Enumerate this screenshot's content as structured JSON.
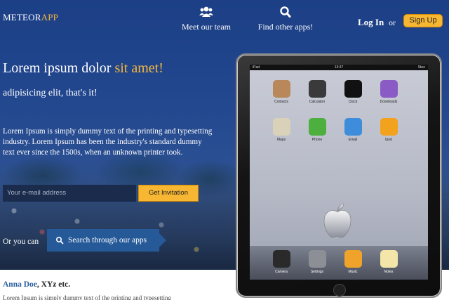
{
  "header": {
    "logo_main": "METEOR",
    "logo_accent": "APP",
    "nav": [
      {
        "label": "Meet our team",
        "icon": "users-icon"
      },
      {
        "label": "Find other apps!",
        "icon": "search-icon"
      }
    ],
    "login_label": "Log In",
    "or_label": "or",
    "signup_label": "Sign Up"
  },
  "hero": {
    "headline_main": "Lorem ipsum dolor ",
    "headline_accent": "sit amet!",
    "subheadline": "adipisicing elit, that's it!",
    "description": "Lorem Ipsum is simply dummy text of the printing and typesetting industry. Lorem Ipsum has been the industry's standard dummy text ever since the 1500s, when an unknown printer took.",
    "email_placeholder": "Your e-mail address",
    "invite_label": "Get Invitation",
    "or_you_can": "Or you can",
    "search_label": "Search through our apps"
  },
  "testimonial": {
    "author_name": "Anna Doe",
    "author_rest": ", XYz etc.",
    "text": "Lorem Ipsum is simply dummy text of the printing and typesetting"
  },
  "tablet": {
    "status_left": "iPad",
    "status_center": "13:37",
    "status_right": "Stee",
    "apps": [
      {
        "label": "Contacts",
        "color": "#b8875a",
        "icon": "contacts-icon"
      },
      {
        "label": "Calculator",
        "color": "#3a3a3a",
        "icon": "calculator-icon"
      },
      {
        "label": "Clock",
        "color": "#111111",
        "icon": "clock-icon"
      },
      {
        "label": "Downloads",
        "color": "#8a5bc4",
        "icon": "downloads-icon"
      },
      {
        "label": "Maps",
        "color": "#d9d2b8",
        "icon": "maps-icon"
      },
      {
        "label": "Phone",
        "color": "#4caf3e",
        "icon": "phone-icon"
      },
      {
        "label": "Email",
        "color": "#3d8ddb",
        "icon": "email-icon"
      },
      {
        "label": "Ipod",
        "color": "#f2a21c",
        "icon": "ipod-icon"
      }
    ],
    "dock": [
      {
        "label": "Camera",
        "color": "#2a2a2a",
        "icon": "camera-icon"
      },
      {
        "label": "Settings",
        "color": "#8d8f96",
        "icon": "settings-icon"
      },
      {
        "label": "Music",
        "color": "#f0a32a",
        "icon": "music-icon"
      },
      {
        "label": "Notes",
        "color": "#f3e6a8",
        "icon": "notes-icon"
      }
    ]
  }
}
